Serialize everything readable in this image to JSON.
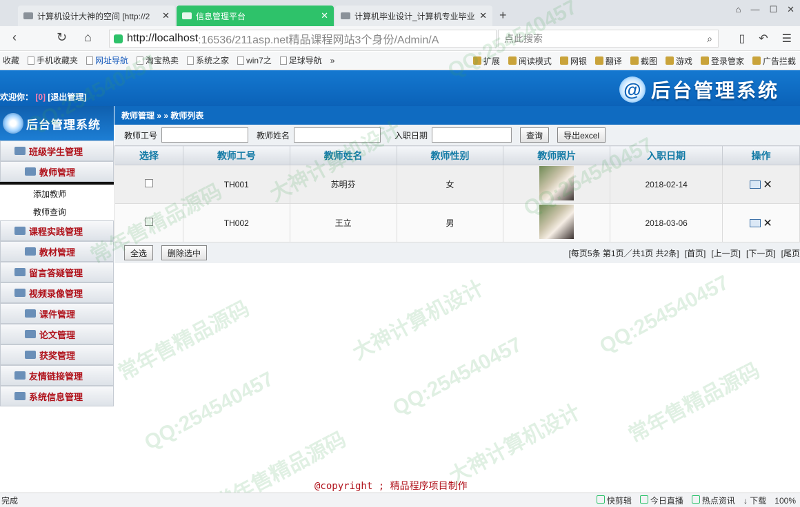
{
  "browser": {
    "tabs": [
      {
        "title": "计算机设计大神的空间 [http://2"
      },
      {
        "title": "信息管理平台"
      },
      {
        "title": "计算机毕业设计_计算机专业毕业"
      }
    ],
    "new_tab": "+",
    "url_host": "http://localhost",
    "url_rest": ":16536/211asp.net精品课程网站3个身份/Admin/A",
    "search_placeholder": "点此搜索",
    "bookmarks": [
      "收藏",
      "手机收藏夹",
      "网址导航",
      "淘宝热卖",
      "系统之家",
      "win7之",
      "足球导航"
    ],
    "bookmark_more": "»",
    "toolbar_right": [
      "扩展",
      "阅读模式",
      "网银",
      "翻译",
      "截图",
      "游戏",
      "登录管家",
      "广告拦截"
    ]
  },
  "header": {
    "welcome": "欢迎你：",
    "user": "[0]",
    "logout": "[退出管理]",
    "brand_symbol": "@",
    "brand_title": "后台管理系统"
  },
  "sidebar": {
    "title": "后台管理系统",
    "groups": [
      {
        "label": "班级学生管理"
      },
      {
        "label": "教师管理",
        "children": [
          "添加教师",
          "教师查询"
        ]
      },
      {
        "label": "课程实践管理"
      },
      {
        "label": "教材管理"
      },
      {
        "label": "留言答疑管理"
      },
      {
        "label": "视频录像管理"
      },
      {
        "label": "课件管理"
      },
      {
        "label": "论文管理"
      },
      {
        "label": "获奖管理"
      },
      {
        "label": "友情链接管理"
      },
      {
        "label": "系统信息管理"
      }
    ]
  },
  "main": {
    "breadcrumb": "教师管理 » » 教师列表",
    "filters": {
      "teacher_no_label": "教师工号",
      "teacher_name_label": "教师姓名",
      "hire_date_label": "入职日期",
      "teacher_no_value": "",
      "teacher_name_value": "",
      "hire_date_value": "",
      "query_label": "查询",
      "export_label": "导出excel"
    },
    "table": {
      "headers": [
        "选择",
        "教师工号",
        "教师姓名",
        "教师性别",
        "教师照片",
        "入职日期",
        "操作"
      ],
      "rows": [
        {
          "id": "TH001",
          "name": "苏明芬",
          "gender": "女",
          "hire_date": "2018-02-14"
        },
        {
          "id": "TH002",
          "name": "王立",
          "gender": "男",
          "hire_date": "2018-03-06"
        }
      ]
    },
    "pager": {
      "select_all": "全选",
      "delete_selected": "删除选中",
      "info": "[每页5条 第1页／共1页 共2条]",
      "first": "[首页]",
      "prev": "[上一页]",
      "next": "[下一页]",
      "last": "[尾页"
    }
  },
  "footer": {
    "copyright": "@copyright ; 精品程序项目制作"
  },
  "statusbar": {
    "left": "完成",
    "items": [
      "快剪辑",
      "今日直播",
      "热点资讯",
      "下载",
      "100%"
    ]
  },
  "watermarks": [
    "大神计算机设计",
    "QQ:254540457",
    "常年售精品源码"
  ]
}
